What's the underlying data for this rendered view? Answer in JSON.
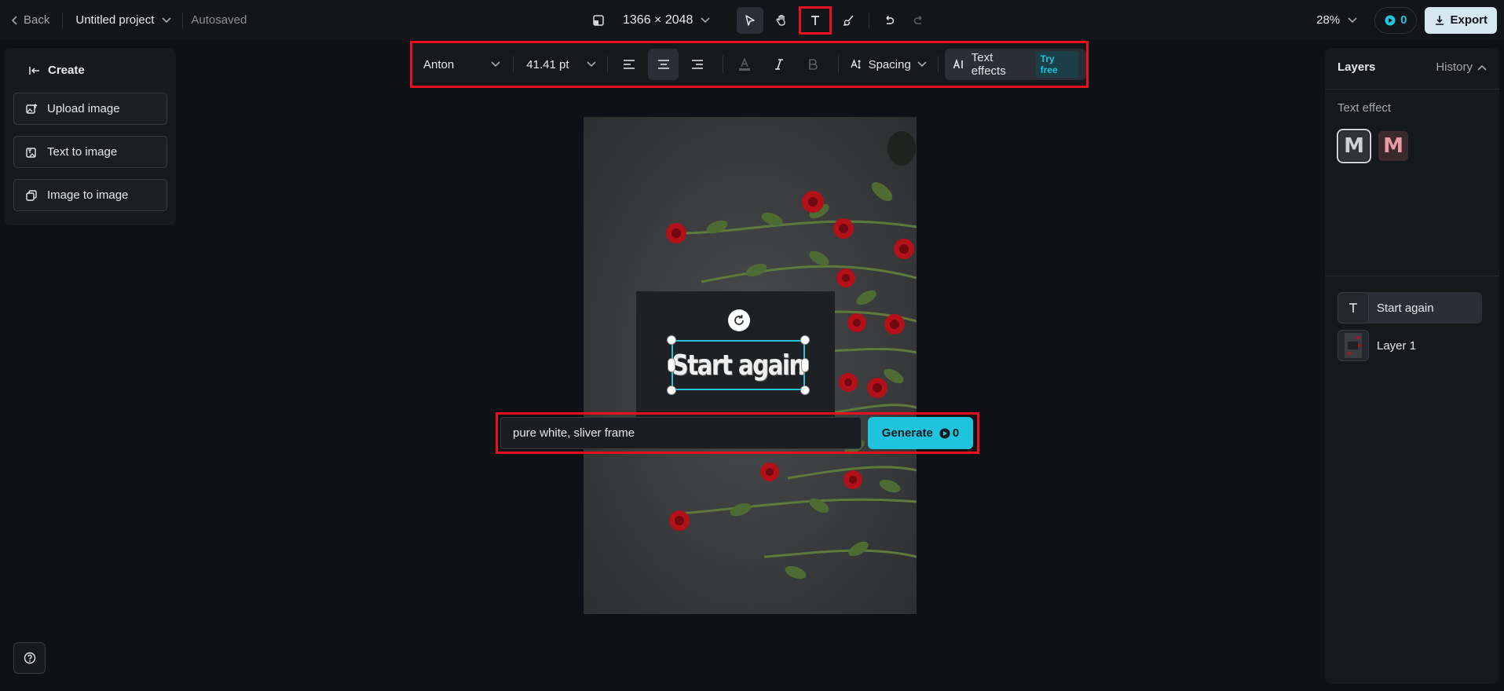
{
  "topbar": {
    "back_label": "Back",
    "project_name": "Untitled project",
    "autosave_status": "Autosaved",
    "canvas_dims": "1366 × 2048",
    "zoom": "28%",
    "credits": "0",
    "export_label": "Export"
  },
  "left_panel": {
    "title": "Create",
    "buttons": [
      {
        "label": "Upload image"
      },
      {
        "label": "Text to image"
      },
      {
        "label": "Image to image"
      }
    ]
  },
  "format_bar": {
    "font": "Anton",
    "font_size": "41.41 pt",
    "spacing_label": "Spacing",
    "text_effects_label": "Text effects",
    "try_free_label": "Try free"
  },
  "canvas": {
    "selected_text": "Start again"
  },
  "prompt": {
    "value": "pure white, sliver frame",
    "generate_label": "Generate",
    "generate_cost": "0"
  },
  "right_panel": {
    "layers_title": "Layers",
    "history_label": "History",
    "text_effect_label": "Text effect",
    "effect_glyph": "M",
    "layers": [
      {
        "name": "Start again"
      },
      {
        "name": "Layer 1"
      }
    ]
  },
  "colors": {
    "accent": "#1fc3dc",
    "highlight": "#e8101e",
    "background": "#0e1116"
  }
}
